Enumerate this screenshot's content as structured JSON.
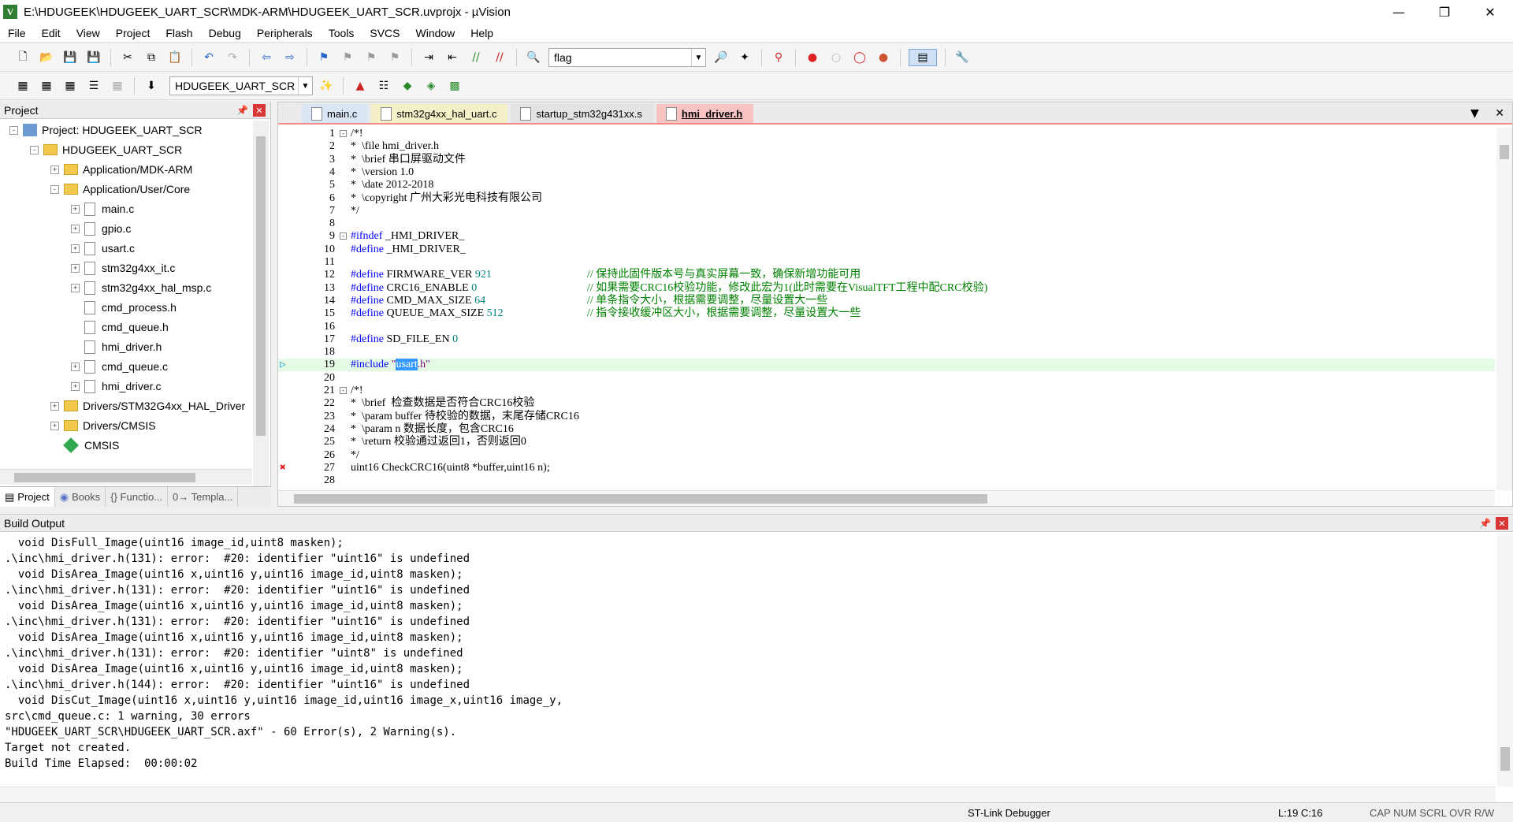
{
  "window": {
    "title": "E:\\HDUGEEK\\HDUGEEK_UART_SCR\\MDK-ARM\\HDUGEEK_UART_SCR.uvprojx - µVision",
    "app_icon": "V"
  },
  "menu": [
    "File",
    "Edit",
    "View",
    "Project",
    "Flash",
    "Debug",
    "Peripherals",
    "Tools",
    "SVCS",
    "Window",
    "Help"
  ],
  "toolbar": {
    "find_value": "flag",
    "target_value": "HDUGEEK_UART_SCR"
  },
  "project_panel": {
    "title": "Project",
    "tree": [
      {
        "label": "Project: HDUGEEK_UART_SCR",
        "level": 0,
        "kind": "project",
        "exp": "-"
      },
      {
        "label": "HDUGEEK_UART_SCR",
        "level": 1,
        "kind": "folder",
        "exp": "-"
      },
      {
        "label": "Application/MDK-ARM",
        "level": 2,
        "kind": "folder",
        "exp": "+"
      },
      {
        "label": "Application/User/Core",
        "level": 2,
        "kind": "folder",
        "exp": "-"
      },
      {
        "label": "main.c",
        "level": 3,
        "kind": "file",
        "exp": "+"
      },
      {
        "label": "gpio.c",
        "level": 3,
        "kind": "file",
        "exp": "+"
      },
      {
        "label": "usart.c",
        "level": 3,
        "kind": "file",
        "exp": "+"
      },
      {
        "label": "stm32g4xx_it.c",
        "level": 3,
        "kind": "file",
        "exp": "+"
      },
      {
        "label": "stm32g4xx_hal_msp.c",
        "level": 3,
        "kind": "file",
        "exp": "+"
      },
      {
        "label": "cmd_process.h",
        "level": 3,
        "kind": "file",
        "exp": ""
      },
      {
        "label": "cmd_queue.h",
        "level": 3,
        "kind": "file",
        "exp": ""
      },
      {
        "label": "hmi_driver.h",
        "level": 3,
        "kind": "file",
        "exp": ""
      },
      {
        "label": "cmd_queue.c",
        "level": 3,
        "kind": "file",
        "exp": "+"
      },
      {
        "label": "hmi_driver.c",
        "level": 3,
        "kind": "file",
        "exp": "+"
      },
      {
        "label": "Drivers/STM32G4xx_HAL_Driver",
        "level": 2,
        "kind": "folder",
        "exp": "+"
      },
      {
        "label": "Drivers/CMSIS",
        "level": 2,
        "kind": "folder",
        "exp": "+"
      },
      {
        "label": "CMSIS",
        "level": 2,
        "kind": "diamond",
        "exp": ""
      }
    ],
    "bottom_tabs": [
      "Project",
      "Books",
      "{} Functio...",
      "0→ Templa..."
    ]
  },
  "editor": {
    "tabs": [
      "main.c",
      "stm32g4xx_hal_uart.c",
      "startup_stm32g431xx.s",
      "hmi_driver.h"
    ],
    "current_line": 19,
    "lines": [
      {
        "n": "1",
        "t": "/*!",
        "cls": "comment",
        "fold": "-"
      },
      {
        "n": "2",
        "t": "*  \\file hmi_driver.h",
        "cls": "comment"
      },
      {
        "n": "3",
        "t": "*  \\brief 串口屏驱动文件",
        "cls": "comment"
      },
      {
        "n": "4",
        "t": "*  \\version 1.0",
        "cls": "comment"
      },
      {
        "n": "5",
        "t": "*  \\date 2012-2018",
        "cls": "comment"
      },
      {
        "n": "6",
        "t": "*  \\copyright 广州大彩光电科技有限公司",
        "cls": "comment"
      },
      {
        "n": "7",
        "t": "*/",
        "cls": "comment"
      },
      {
        "n": "8",
        "t": "",
        "cls": ""
      },
      {
        "n": "9",
        "t": "#ifndef _HMI_DRIVER_",
        "cls": "pp",
        "fold": "-"
      },
      {
        "n": "10",
        "t": "#define _HMI_DRIVER_",
        "cls": "pp"
      },
      {
        "n": "11",
        "t": "",
        "cls": ""
      },
      {
        "n": "12",
        "t": "#define FIRMWARE_VER 921",
        "cls": "def",
        "cm": "// 保持此固件版本号与真实屏幕一致，确保新增功能可用"
      },
      {
        "n": "13",
        "t": "#define CRC16_ENABLE 0",
        "cls": "def",
        "cm": "// 如果需要CRC16校验功能，修改此宏为1(此时需要在VisualTFT工程中配CRC校验)"
      },
      {
        "n": "14",
        "t": "#define CMD_MAX_SIZE 64",
        "cls": "def",
        "cm": "// 单条指令大小，根据需要调整，尽量设置大一些"
      },
      {
        "n": "15",
        "t": "#define QUEUE_MAX_SIZE 512",
        "cls": "def",
        "cm": "// 指令接收缓冲区大小，根据需要调整，尽量设置大一些"
      },
      {
        "n": "16",
        "t": "",
        "cls": ""
      },
      {
        "n": "17",
        "t": "#define SD_FILE_EN 0",
        "cls": "def"
      },
      {
        "n": "18",
        "t": "",
        "cls": ""
      },
      {
        "n": "19",
        "t": "#include \"usart.h\"",
        "cls": "inc"
      },
      {
        "n": "20",
        "t": "",
        "cls": ""
      },
      {
        "n": "21",
        "t": "/*!",
        "cls": "comment",
        "fold": "-"
      },
      {
        "n": "22",
        "t": "*  \\brief  检查数据是否符合CRC16校验",
        "cls": "comment"
      },
      {
        "n": "23",
        "t": "*  \\param buffer 待校验的数据，末尾存储CRC16",
        "cls": "comment"
      },
      {
        "n": "24",
        "t": "*  \\param n 数据长度，包含CRC16",
        "cls": "comment"
      },
      {
        "n": "25",
        "t": "*  \\return 校验通过返回1，否则返回0",
        "cls": "comment"
      },
      {
        "n": "26",
        "t": "*/",
        "cls": "comment"
      },
      {
        "n": "27",
        "t": "uint16 CheckCRC16(uint8 *buffer,uint16 n);",
        "cls": "err"
      },
      {
        "n": "28",
        "t": "",
        "cls": ""
      }
    ]
  },
  "build_output": {
    "title": "Build Output",
    "lines": [
      "  void DisFull_Image(uint16 image_id,uint8 masken);",
      ".\\inc\\hmi_driver.h(131): error:  #20: identifier \"uint16\" is undefined",
      "  void DisArea_Image(uint16 x,uint16 y,uint16 image_id,uint8 masken);",
      ".\\inc\\hmi_driver.h(131): error:  #20: identifier \"uint16\" is undefined",
      "  void DisArea_Image(uint16 x,uint16 y,uint16 image_id,uint8 masken);",
      ".\\inc\\hmi_driver.h(131): error:  #20: identifier \"uint16\" is undefined",
      "  void DisArea_Image(uint16 x,uint16 y,uint16 image_id,uint8 masken);",
      ".\\inc\\hmi_driver.h(131): error:  #20: identifier \"uint8\" is undefined",
      "  void DisArea_Image(uint16 x,uint16 y,uint16 image_id,uint8 masken);",
      ".\\inc\\hmi_driver.h(144): error:  #20: identifier \"uint16\" is undefined",
      "  void DisCut_Image(uint16 x,uint16 y,uint16 image_id,uint16 image_x,uint16 image_y,",
      "src\\cmd_queue.c: 1 warning, 30 errors",
      "\"HDUGEEK_UART_SCR\\HDUGEEK_UART_SCR.axf\" - 60 Error(s), 2 Warning(s).",
      "Target not created.",
      "Build Time Elapsed:  00:00:02"
    ]
  },
  "status": {
    "debugger": "ST-Link Debugger",
    "position": "L:19 C:16",
    "flags": "CAP  NUM  SCRL  OVR  R/W"
  }
}
